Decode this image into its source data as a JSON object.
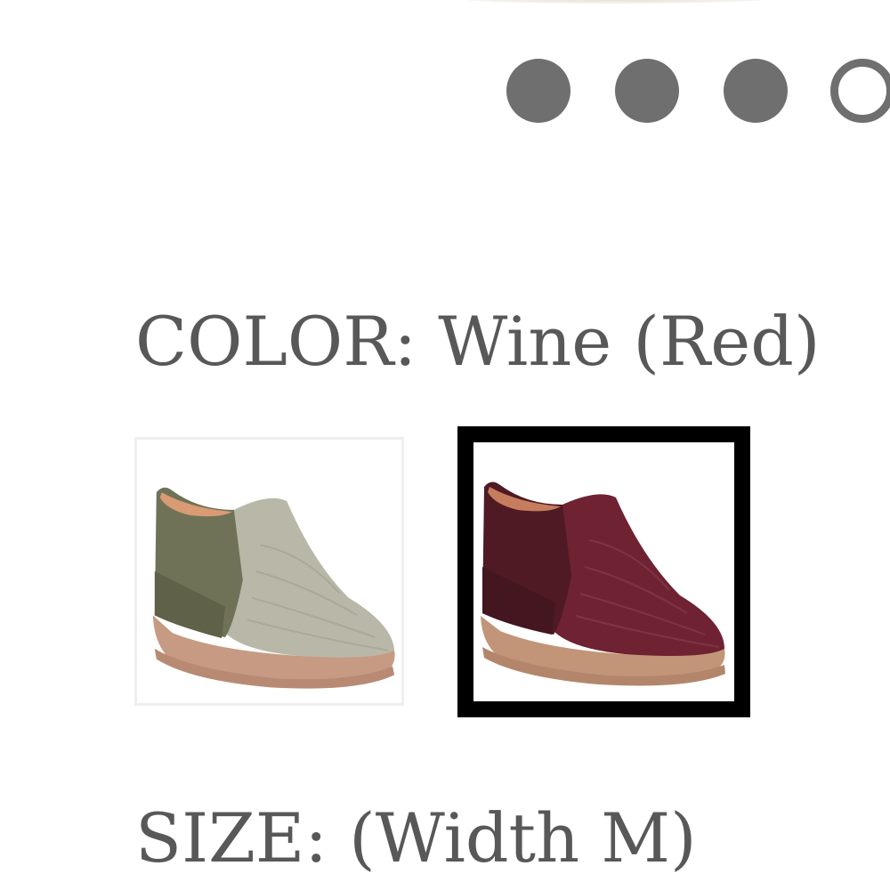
{
  "carousel": {
    "dots": [
      {
        "state": "filled",
        "icon": "carousel-dot-icon"
      },
      {
        "state": "filled",
        "icon": "carousel-dot-icon"
      },
      {
        "state": "filled",
        "icon": "carousel-dot-icon"
      },
      {
        "state": "active",
        "icon": "carousel-dot-active-icon"
      }
    ],
    "dot_color": "#6f6f6f"
  },
  "color_section": {
    "label": "COLOR:",
    "selected_value": "Wine (Red)",
    "swatches": [
      {
        "name": "sage",
        "selected": false,
        "shoe_color": "#a8a898",
        "accent_color": "#6d7055"
      },
      {
        "name": "wine",
        "selected": true,
        "shoe_color": "#6e2232",
        "accent_color": "#4a1a22"
      }
    ],
    "selected_border_color": "#000000"
  },
  "size_section": {
    "label": "SIZE:",
    "width_note": "(Width M)"
  },
  "text_color": "#585858"
}
